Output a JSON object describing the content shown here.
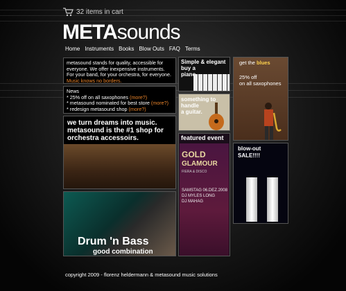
{
  "header": {
    "cart_text": "32 items in cart",
    "logo_bold": "META",
    "logo_light": "sounds"
  },
  "nav": {
    "items": [
      "Home",
      "Instruments",
      "Books",
      "Blow Outs",
      "FAQ",
      "Terms"
    ]
  },
  "about": {
    "text": "metasound stands for quality, accessible for everyone. We offer inexpensive instruments. For your band, for your orchestra, for everyone.",
    "highlight": "Music knows no borders."
  },
  "news": {
    "title": "News",
    "items": [
      {
        "text": "* 25% off on all saxophones ",
        "more": "(more?)"
      },
      {
        "text": "* metasound nominated for best store ",
        "more": "(more?)"
      },
      {
        "text": "* redesign metasound shop ",
        "more": "(more?)"
      }
    ]
  },
  "dream": {
    "line1": "we turn dreams into music.",
    "line2": "metasound is the #1 shop for",
    "line3": "orchestra accessoirs."
  },
  "drum": {
    "title": "Drum 'n Bass",
    "subtitle": "good combination"
  },
  "piano": {
    "line1": "Simple & elegant",
    "line2": "buy a",
    "line3": "piano"
  },
  "guitar": {
    "line1": "something to",
    "line2": "handle",
    "line3": "a guitar."
  },
  "blues": {
    "get_the": "get the ",
    "blues": "blues",
    "offer1": "25% off",
    "offer2": "on all saxophones"
  },
  "featured": {
    "title": "featured event",
    "poster_line1": "GOLD",
    "poster_line2": "GLAMOUR",
    "poster_tagline": "FIERA & DISCO",
    "date": "SAMSTAG 06.DEZ.2008",
    "dj1": "DJ MYLES LONG",
    "dj2": "DJ MAHAG"
  },
  "blowout": {
    "line1": "blow-out",
    "line2": "SALE!!!!"
  },
  "footer": {
    "copyright": "copyright 2009 - florenz heldermann & metasound music solutions"
  },
  "colors": {
    "accent": "#e8832a",
    "blues_highlight": "#ffd24d"
  }
}
